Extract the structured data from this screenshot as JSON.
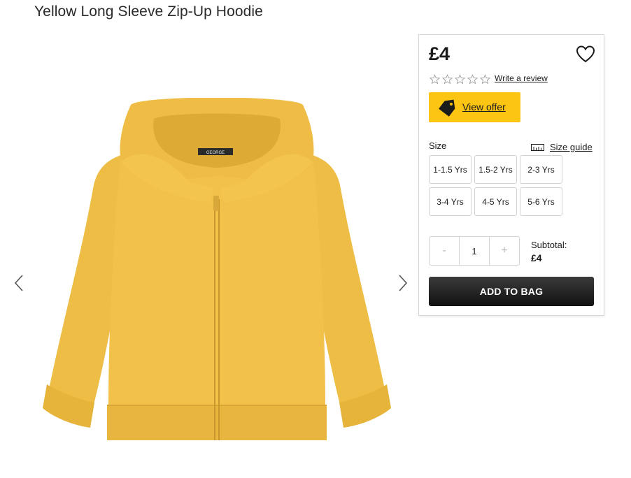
{
  "product": {
    "title": "Yellow Long Sleeve Zip-Up Hoodie"
  },
  "buy_box": {
    "price": "£4",
    "rating": {
      "stars_filled": 0,
      "stars_total": 5
    },
    "review_link": "Write a review",
    "offer_button": "View offer",
    "size_label": "Size",
    "size_guide": "Size guide",
    "sizes": [
      "1-1.5 Yrs",
      "1.5-2 Yrs",
      "2-3 Yrs",
      "3-4 Yrs",
      "4-5 Yrs",
      "5-6 Yrs"
    ],
    "quantity": {
      "minus": "-",
      "value": "1",
      "plus": "+"
    },
    "subtotal_label": "Subtotal:",
    "subtotal_value": "£4",
    "add_to_bag": "ADD TO BAG"
  },
  "image": {
    "garment_label": "GEORGE"
  },
  "colors": {
    "offer_yellow": "#fcc413",
    "hoodie_yellow": "#f1c14a",
    "button_dark": "#1e1e1e"
  },
  "icons": {
    "wishlist": "heart-icon",
    "offer": "price-tag-icon",
    "size_guide": "ruler-icon",
    "prev": "chevron-left-icon",
    "next": "chevron-right-icon"
  }
}
